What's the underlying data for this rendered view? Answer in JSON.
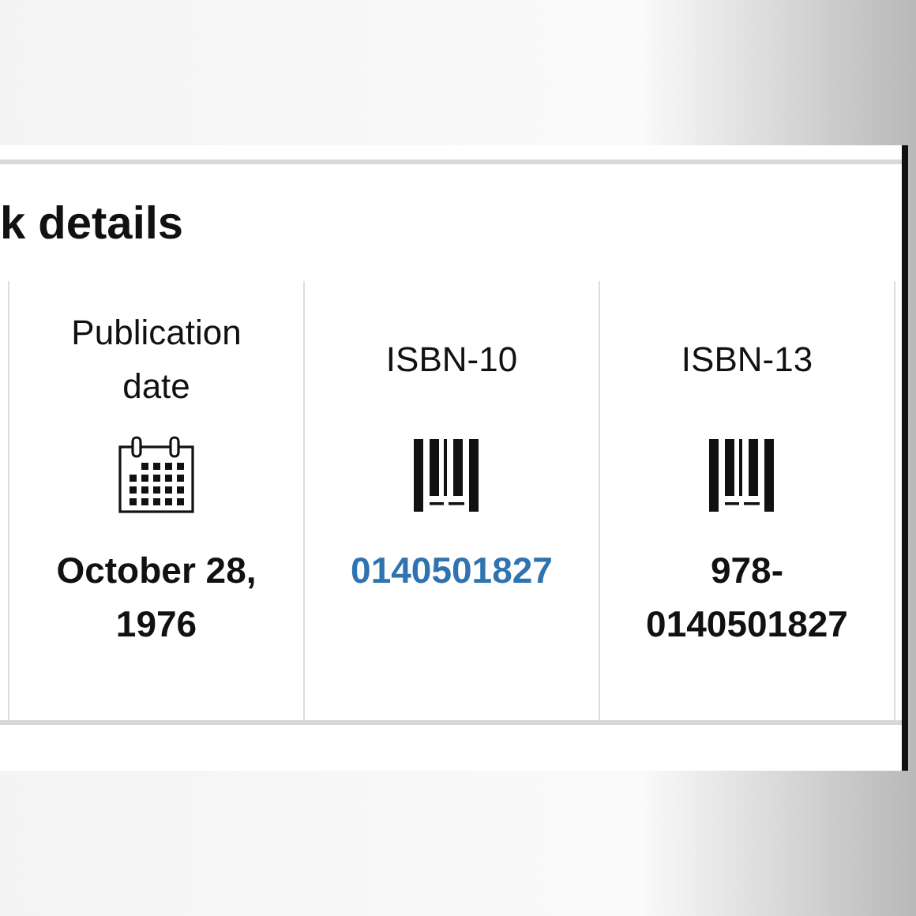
{
  "section": {
    "title": "k details"
  },
  "details": [
    {
      "label": "Publication date",
      "kind": "date",
      "value": "October 28, 1976",
      "link": false
    },
    {
      "label": "ISBN-10",
      "kind": "isbn",
      "value": "0140501827",
      "link": true
    },
    {
      "label": "ISBN-13",
      "kind": "isbn",
      "value": "978-0140501827",
      "link": false
    }
  ]
}
